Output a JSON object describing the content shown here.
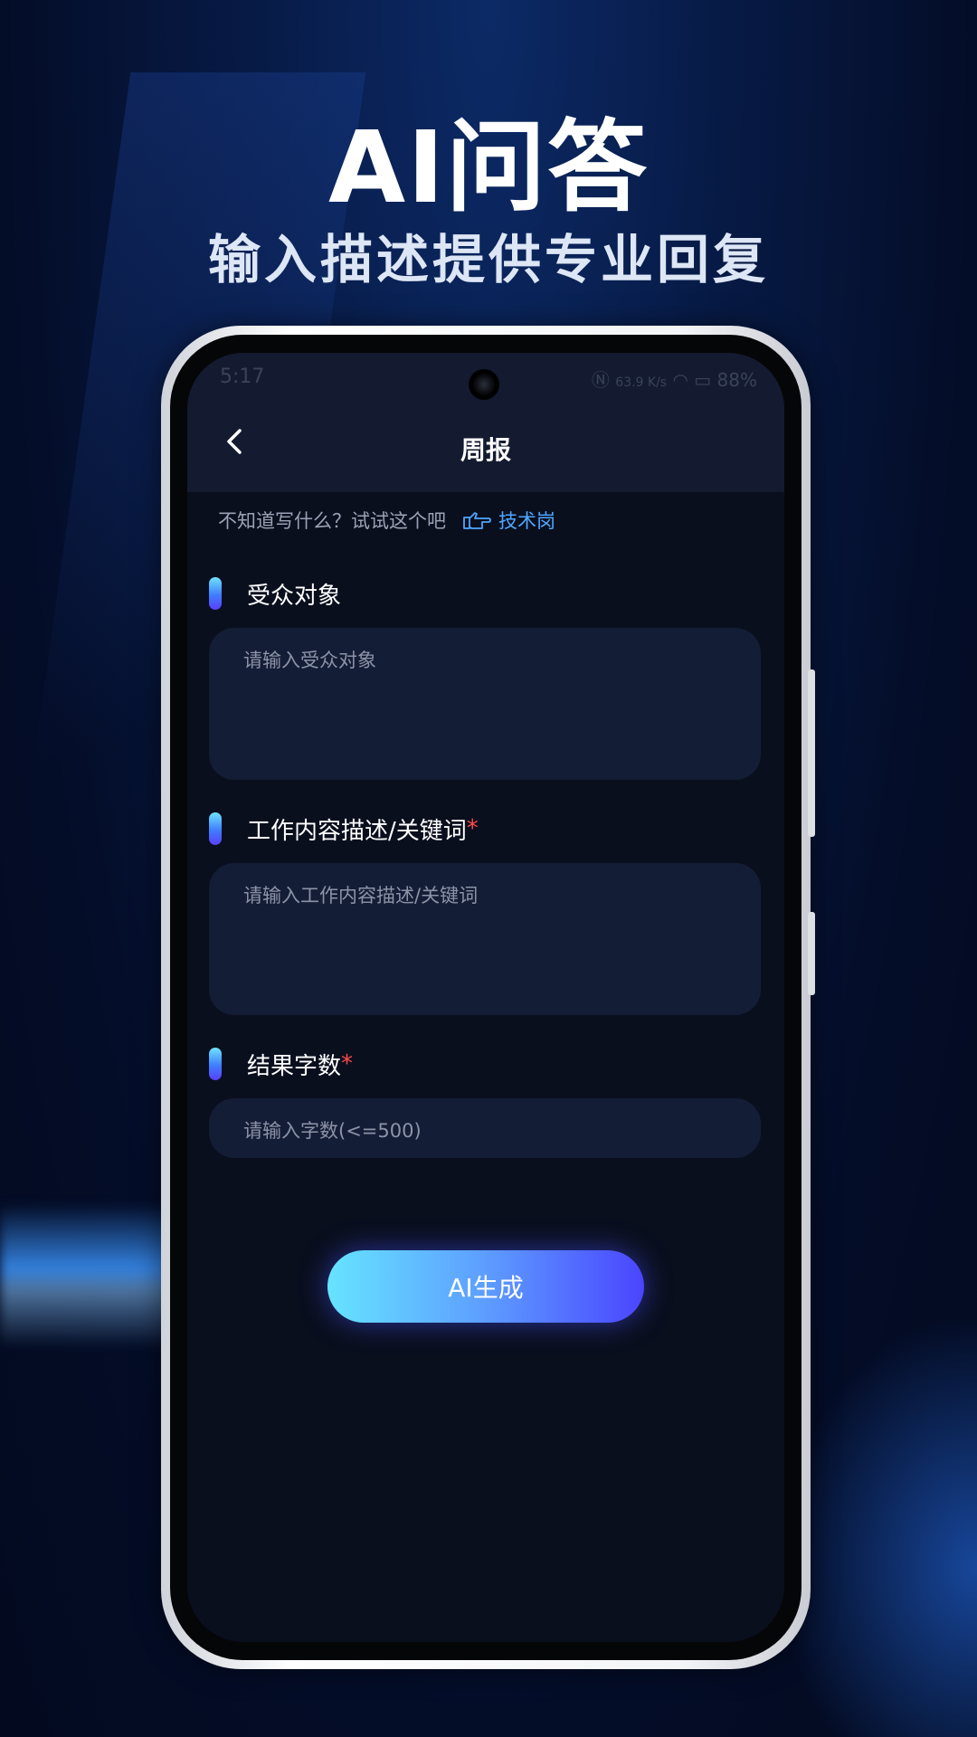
{
  "hero": {
    "title": "AI问答",
    "subtitle": "输入描述提供专业回复"
  },
  "status_bar": {
    "time": "5:17",
    "network_speed": "63.9 K/s",
    "battery": "88%"
  },
  "nav": {
    "title": "周报",
    "back_icon": "chevron-left-icon"
  },
  "hint": {
    "text": "不知道写什么？试试这个吧",
    "icon": "pointing-hand-icon",
    "link": "技术岗"
  },
  "form": {
    "audience": {
      "label": "受众对象",
      "required": "",
      "placeholder": "请输入受众对象"
    },
    "content": {
      "label": "工作内容描述/关键词",
      "required": "*",
      "placeholder": "请输入工作内容描述/关键词"
    },
    "word_count": {
      "label": "结果字数",
      "required": "*",
      "placeholder": "请输入字数(<=500)"
    }
  },
  "generate_button": {
    "label": "AI生成"
  },
  "colors": {
    "accent_start": "#66e4ff",
    "accent_end": "#4a45ff",
    "required": "#ff4a4a",
    "link": "#4fa6ff"
  }
}
